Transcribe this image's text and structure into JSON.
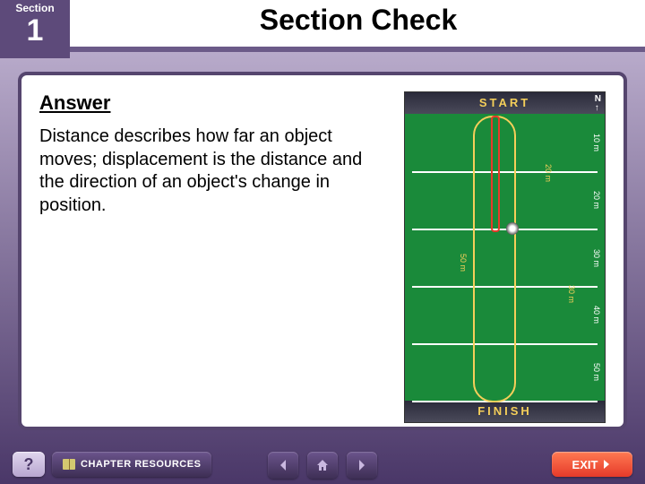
{
  "header": {
    "section_label": "Section",
    "section_number": "1",
    "title": "Section Check"
  },
  "content": {
    "answer_heading": "Answer",
    "answer_body": "Distance describes how far an object moves; displacement is the distance and the direction of an object's change in position."
  },
  "diagram": {
    "start_label": "START",
    "finish_label": "FINISH",
    "yard_labels_right": [
      "10 m",
      "20 m",
      "30 m",
      "40 m",
      "50 m"
    ],
    "path_labels": {
      "a": "20 m",
      "b": "30 m",
      "c": "50 m"
    },
    "compass": "N"
  },
  "footer": {
    "help": "?",
    "chapter_resources": "CHAPTER RESOURCES",
    "exit": "EXIT"
  }
}
